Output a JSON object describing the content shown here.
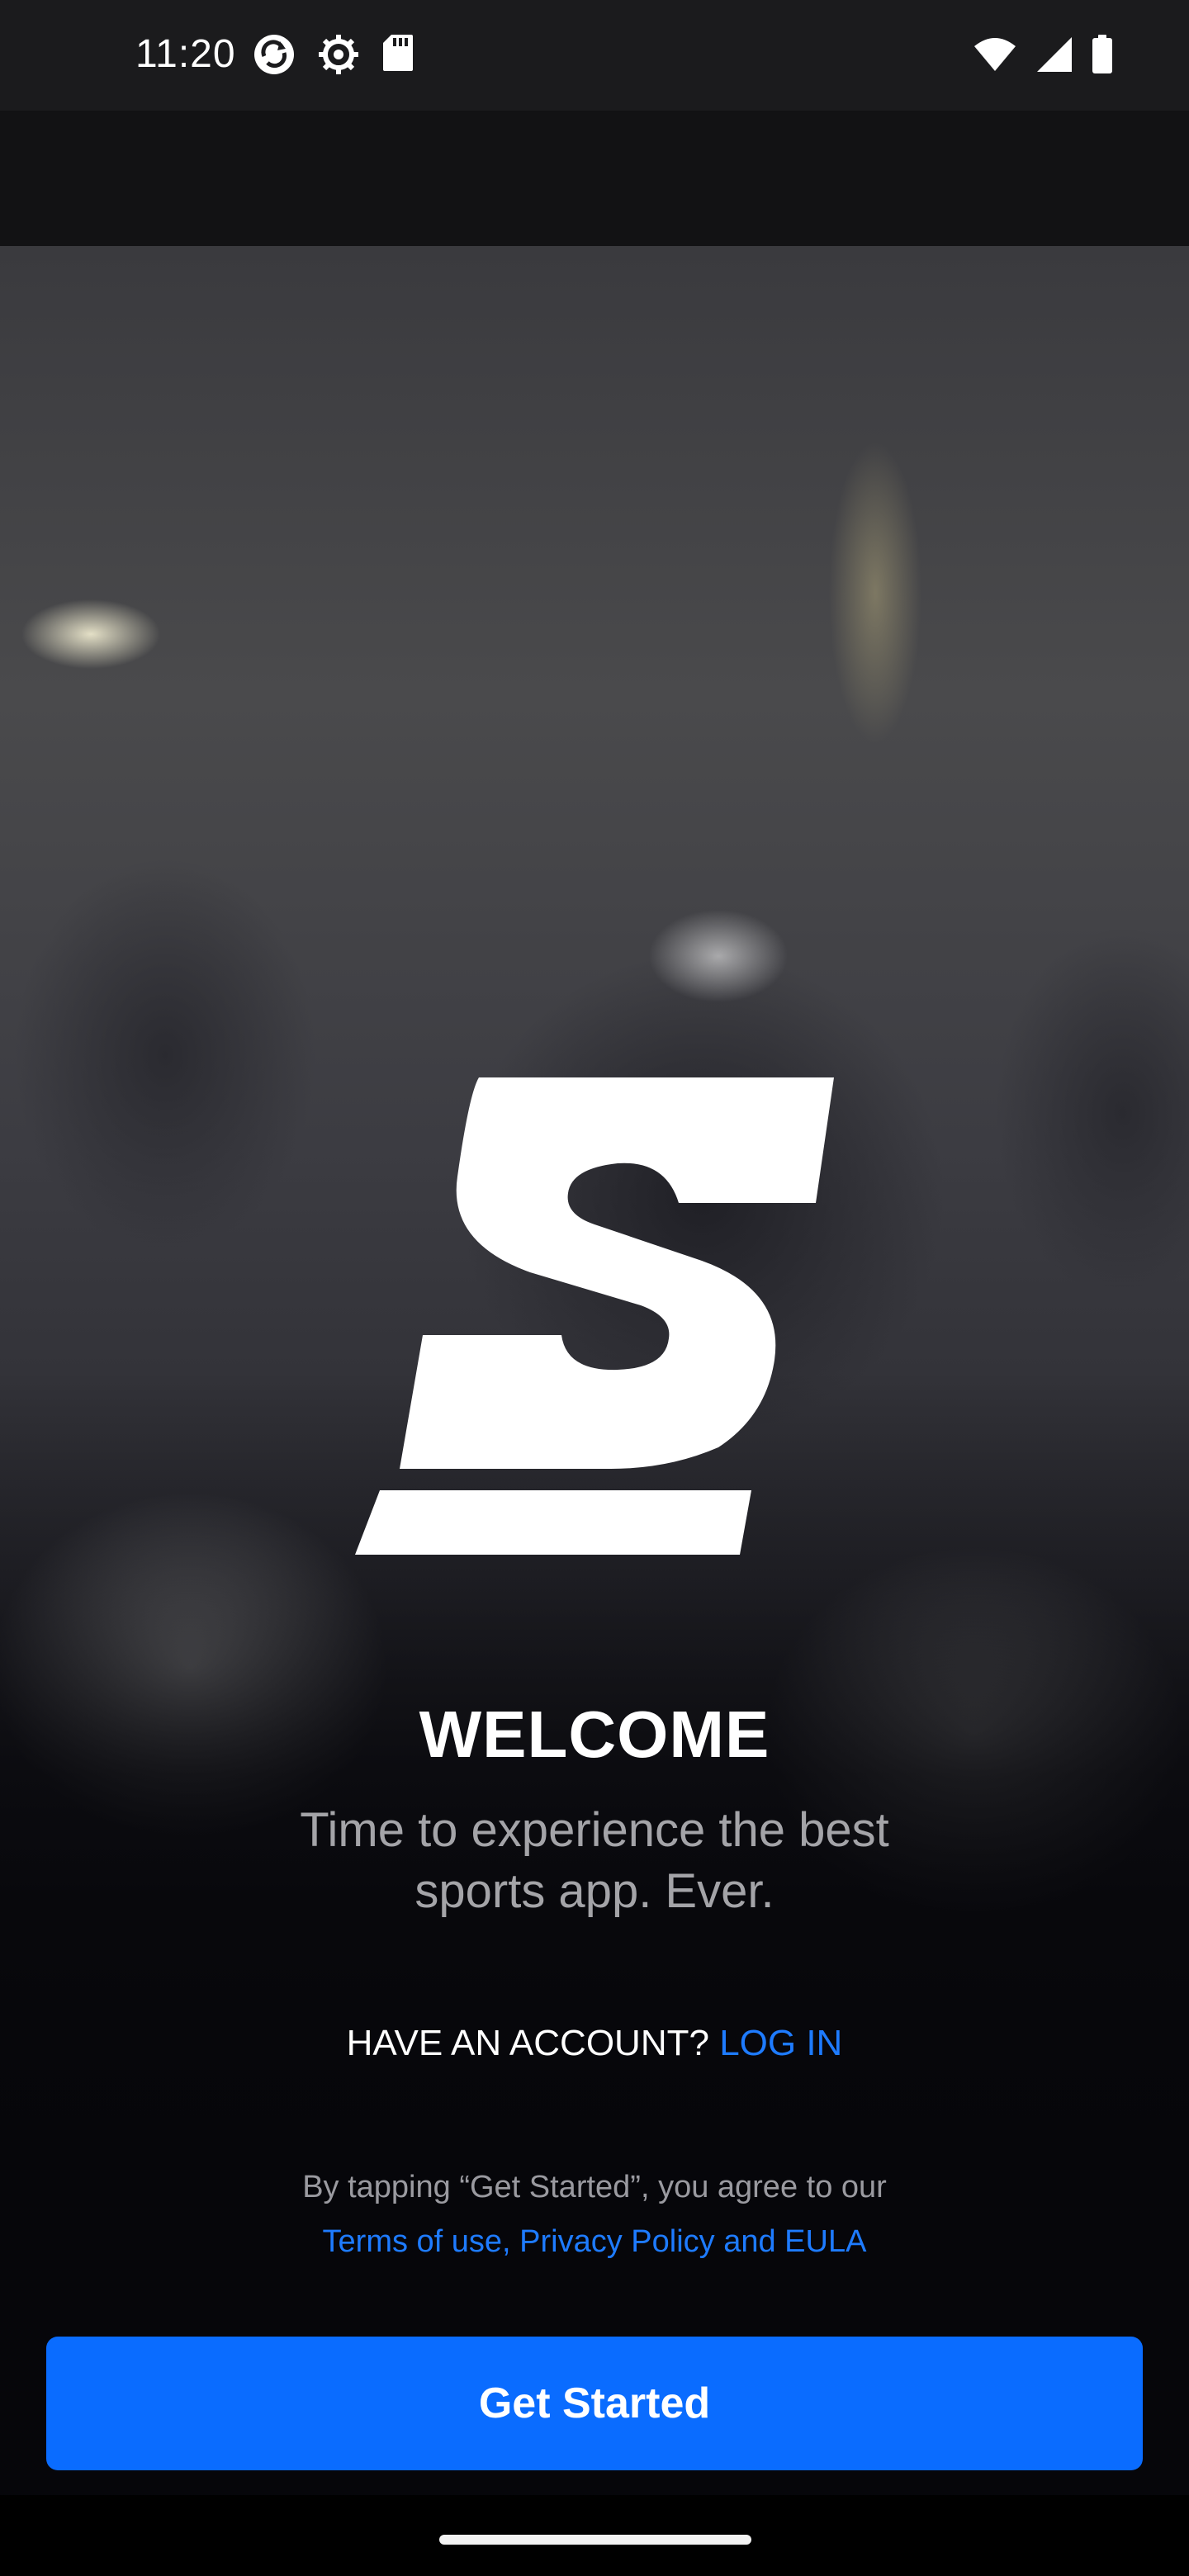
{
  "status_bar": {
    "time": "11:20",
    "left_icons": [
      "sync-icon",
      "settings-icon",
      "sd-card-icon"
    ],
    "right_icons": [
      "wifi-icon",
      "cellular-signal-icon",
      "battery-icon"
    ]
  },
  "hero": {
    "logo_icon": "brand-s-logo-icon"
  },
  "welcome": {
    "title": "WELCOME",
    "tagline_line1": "Time to experience the best",
    "tagline_line2": "sports app. Ever."
  },
  "account": {
    "prompt": "HAVE AN ACCOUNT?",
    "login_label": "LOG IN"
  },
  "legal": {
    "notice": "By tapping “Get Started”, you agree to our",
    "link_text": "Terms of use, Privacy Policy and EULA"
  },
  "cta": {
    "label": "Get Started"
  },
  "colors": {
    "accent": "#0a6cff",
    "link": "#1e7bff",
    "background": "#0c0c0e"
  }
}
